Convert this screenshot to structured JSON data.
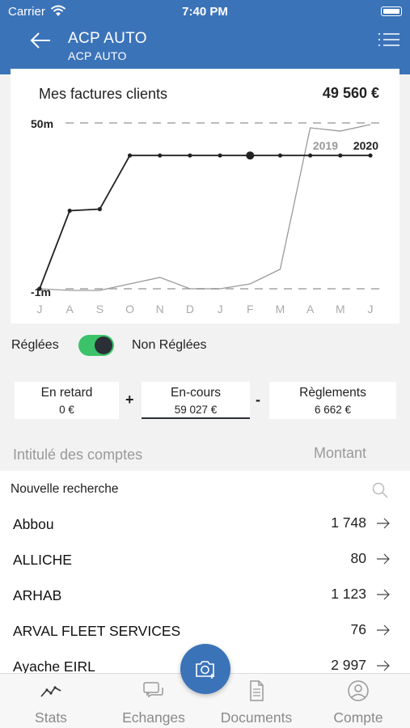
{
  "status": {
    "carrier": "Carrier",
    "time": "7:40 PM"
  },
  "header": {
    "title": "ACP AUTO",
    "subtitle": "ACP AUTO"
  },
  "chart_card": {
    "title": "Mes factures clients",
    "total": "49 560 €"
  },
  "chart_data": {
    "type": "line",
    "x": [
      "J",
      "A",
      "S",
      "O",
      "N",
      "D",
      "J",
      "F",
      "M",
      "A",
      "M",
      "J"
    ],
    "yticks": [
      "50m",
      "-1m"
    ],
    "ylim": [
      -1,
      50
    ],
    "series": [
      {
        "name": "2019",
        "values": [
          -1,
          -1.5,
          -1.5,
          0.5,
          2.5,
          -1,
          -1,
          0.5,
          5,
          48.5,
          47.5,
          49.5
        ]
      },
      {
        "name": "2020",
        "values": [
          -1,
          23,
          23.5,
          40,
          40,
          40,
          40,
          40,
          40,
          40,
          40,
          40
        ]
      }
    ],
    "highlight_index": 7,
    "grid": false,
    "legend_position": "top-right",
    "colors": {
      "2019": "#9a9a9a",
      "2020": "#222222"
    }
  },
  "toggle": {
    "left_label": "Réglées",
    "right_label": "Non Réglées",
    "on": true
  },
  "filters": [
    {
      "title": "En retard",
      "value": "0 €"
    },
    {
      "title": "En-cours",
      "value": "59 027 €"
    },
    {
      "title": "Règlements",
      "value": "6 662 €"
    }
  ],
  "operators": [
    "+",
    "-"
  ],
  "list_header": {
    "account": "Intitulé des comptes",
    "amount": "Montant"
  },
  "search": {
    "placeholder": "Nouvelle recherche"
  },
  "accounts": [
    {
      "name": "Abbou",
      "amount": "1 748"
    },
    {
      "name": "ALLICHE",
      "amount": "80"
    },
    {
      "name": "ARHAB",
      "amount": "1 123"
    },
    {
      "name": "ARVAL FLEET SERVICES",
      "amount": "76"
    },
    {
      "name": "Ayache EIRL",
      "amount": "2 997"
    }
  ],
  "tabs": [
    {
      "label": "Stats",
      "icon": "chart-line-icon"
    },
    {
      "label": "Echanges",
      "icon": "chat-bubbles-icon"
    },
    {
      "label": "Documents",
      "icon": "document-icon"
    },
    {
      "label": "Compte",
      "icon": "user-circle-icon"
    }
  ],
  "fab": {
    "icon": "camera-add-icon"
  }
}
